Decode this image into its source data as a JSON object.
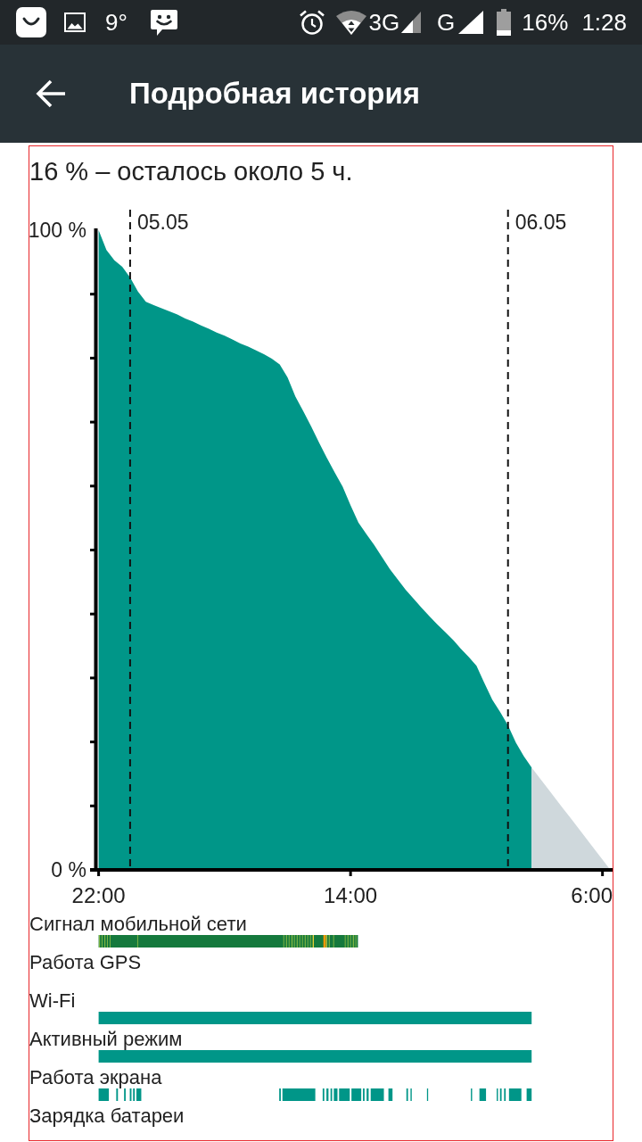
{
  "status_bar": {
    "temperature": "9°",
    "network_types": [
      "3G",
      "G"
    ],
    "battery": "16%",
    "time": "1:28"
  },
  "app_bar": {
    "title": "Подробная история"
  },
  "history": {
    "summary": "16 % – осталось около 5 ч.",
    "chart_data": {
      "type": "area",
      "categories": [
        "22:00",
        null,
        null,
        null,
        null,
        null,
        null,
        null,
        null,
        null,
        null,
        null,
        null,
        null,
        null,
        null,
        null,
        null,
        null,
        null,
        null,
        null,
        null,
        null,
        null,
        null,
        null,
        null,
        null,
        null,
        null,
        null,
        "14:00",
        null,
        null,
        null,
        null,
        null,
        null,
        null,
        null,
        null,
        null,
        null,
        null,
        null,
        null,
        null,
        null,
        null,
        null,
        null,
        null,
        null,
        null,
        null,
        null,
        null,
        null,
        null,
        null,
        null,
        null,
        null,
        "6:00",
        null
      ],
      "series": [
        {
          "color": "#009688",
          "values": [
            100,
            96.9,
            95.3,
            94.3,
            92.6,
            90.4,
            88.8,
            88.3,
            87.8,
            87.3,
            86.8,
            86.2,
            85.7,
            85.1,
            84.6,
            84,
            83.5,
            82.9,
            82.3,
            81.8,
            81.2,
            80.6,
            79.9,
            79,
            77,
            74,
            71.7,
            69.3,
            66.8,
            64.4,
            62.1,
            59.9,
            57,
            54.3,
            52.5,
            50.8,
            48.9,
            47,
            45.4,
            43.8,
            42.4,
            41,
            39.7,
            38.4,
            37.2,
            36,
            34.6,
            33.3,
            31.9,
            29.2,
            26.6,
            24.7,
            22.6,
            19.9,
            17.8,
            16,
            null,
            null,
            null,
            null,
            null,
            null,
            null,
            null,
            null,
            null
          ]
        },
        {
          "color": "#cfd8dc",
          "values": [
            null,
            null,
            null,
            null,
            null,
            null,
            null,
            null,
            null,
            null,
            null,
            null,
            null,
            null,
            null,
            null,
            null,
            null,
            null,
            null,
            null,
            null,
            null,
            null,
            null,
            null,
            null,
            null,
            null,
            null,
            null,
            null,
            null,
            null,
            null,
            null,
            null,
            null,
            null,
            null,
            null,
            null,
            null,
            null,
            null,
            null,
            null,
            null,
            null,
            null,
            null,
            null,
            null,
            null,
            null,
            16,
            14.4,
            12.8,
            11.2,
            9.6,
            8,
            6.4,
            4.8,
            3.2,
            1.6,
            0
          ]
        }
      ],
      "ylim": [
        0,
        100
      ],
      "yticks": [
        {
          "value": 0,
          "label": "0 %"
        },
        {
          "value": 100,
          "label": "100 %"
        }
      ],
      "annotations": [
        "05.05",
        "06.05"
      ]
    },
    "timelines": [
      {
        "label": "Сигнал мобильной сети",
        "kind": "signal"
      },
      {
        "label": "Работа GPS",
        "kind": "none"
      },
      {
        "label": "Wi-Fi",
        "kind": "solid"
      },
      {
        "label": "Активный режим",
        "kind": "solid"
      },
      {
        "label": "Работа экрана",
        "kind": "segmented"
      },
      {
        "label": "Зарядка батареи",
        "kind": "none"
      }
    ]
  }
}
